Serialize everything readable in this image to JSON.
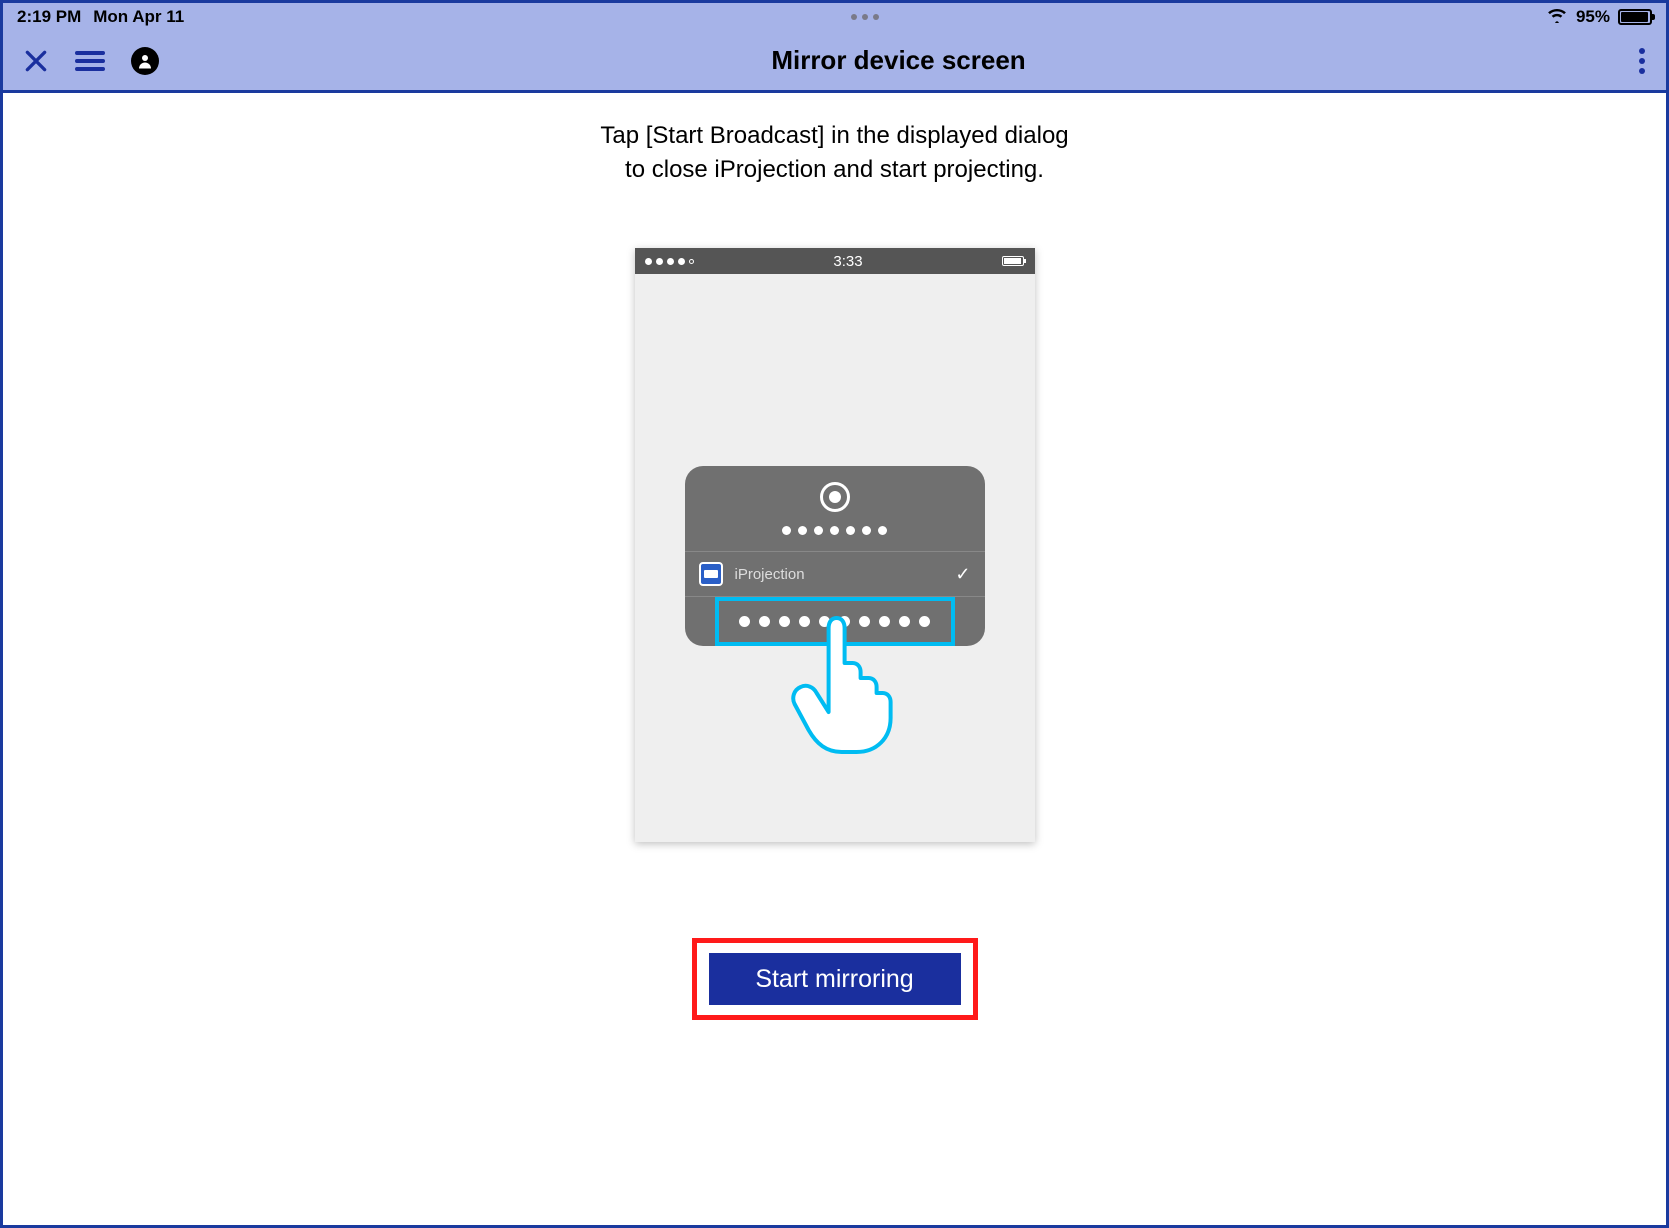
{
  "status": {
    "time": "2:19 PM",
    "date": "Mon Apr 11",
    "battery_pct": "95%"
  },
  "header": {
    "title": "Mirror device screen"
  },
  "instruction": {
    "line1": "Tap [Start Broadcast] in the displayed dialog",
    "line2": "to close iProjection and start projecting."
  },
  "phone": {
    "clock": "3:33",
    "dialog_app": "iProjection"
  },
  "buttons": {
    "start_mirroring": "Start mirroring"
  }
}
